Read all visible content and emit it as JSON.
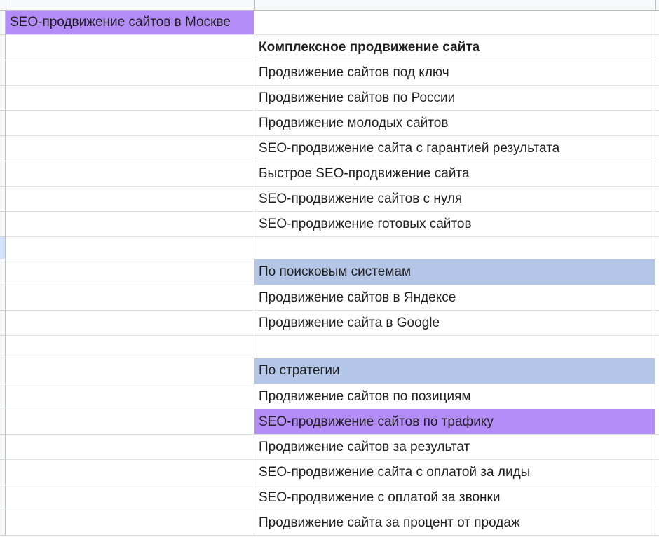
{
  "sheet": {
    "colA_header_cell": "SEO-продвижение сайтов в Москве",
    "rows": [
      {
        "b": "Комплексное продвижение сайта",
        "style": "bold"
      },
      {
        "b": "Продвижение сайтов под ключ",
        "style": ""
      },
      {
        "b": "Продвижение сайтов по России",
        "style": ""
      },
      {
        "b": "Продвижение молодых сайтов",
        "style": ""
      },
      {
        "b": "SEO-продвижение сайта с гарантией результата",
        "style": ""
      },
      {
        "b": "Быстрое SEO-продвижение сайта",
        "style": ""
      },
      {
        "b": "SEO-продвижение сайтов с нуля",
        "style": ""
      },
      {
        "b": "SEO-продвижение готовых сайтов",
        "style": ""
      },
      {
        "b": "",
        "style": ""
      },
      {
        "b": "По поисковым системам",
        "style": "blue"
      },
      {
        "b": "Продвижение сайтов в Яндексе",
        "style": ""
      },
      {
        "b": "Продвижение сайта в Google",
        "style": ""
      },
      {
        "b": "",
        "style": ""
      },
      {
        "b": "По стратегии",
        "style": "blue"
      },
      {
        "b": "Продвижение сайтов по позициям",
        "style": ""
      },
      {
        "b": "SEO-продвижение сайтов по трафику",
        "style": "purple"
      },
      {
        "b": "Продвижение сайтов за результат",
        "style": ""
      },
      {
        "b": "SEO-продвижение сайта с оплатой за лиды",
        "style": ""
      },
      {
        "b": "SEO-продвижение с оплатой за звонки",
        "style": ""
      },
      {
        "b": "Продвижение сайта за процент от продаж",
        "style": ""
      }
    ]
  },
  "colors": {
    "purple": "#b48cf7",
    "blue": "#b4c6e7"
  }
}
